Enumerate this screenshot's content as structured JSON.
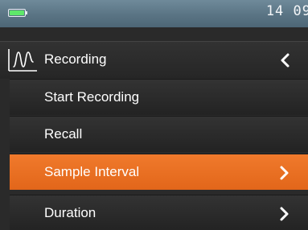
{
  "status_bar": {
    "time": "14 09"
  },
  "header": {
    "title": "Recording",
    "icon": "waveform-icon",
    "back_icon": "chevron-left-icon"
  },
  "menu": {
    "items": [
      {
        "label": "Start Recording",
        "selected": false,
        "has_submenu": false
      },
      {
        "label": "Recall",
        "selected": false,
        "has_submenu": false
      },
      {
        "label": "Sample Interval",
        "selected": true,
        "has_submenu": true
      },
      {
        "label": "Duration",
        "selected": false,
        "has_submenu": true
      }
    ]
  },
  "colors": {
    "accent": "#EC6F22",
    "status_bar": "#5A7484",
    "background": "#2A2A2A",
    "battery": "#5EE86A"
  }
}
